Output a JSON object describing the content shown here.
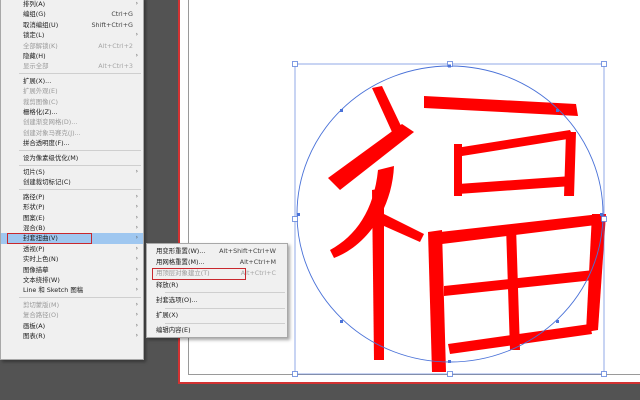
{
  "main_menu": [
    {
      "label": "排列(A)",
      "arrow": true
    },
    {
      "label": "编组(G)",
      "shortcut": "Ctrl+G"
    },
    {
      "label": "取消编组(U)",
      "shortcut": "Shift+Ctrl+G"
    },
    {
      "label": "锁定(L)",
      "arrow": true
    },
    {
      "label": "全部解锁(K)",
      "shortcut": "Alt+Ctrl+2",
      "disabled": true
    },
    {
      "label": "隐藏(H)",
      "arrow": true
    },
    {
      "label": "显示全部",
      "shortcut": "Alt+Ctrl+3",
      "disabled": true
    },
    {
      "sep": true
    },
    {
      "label": "扩展(X)..."
    },
    {
      "label": "扩展外观(E)",
      "disabled": true
    },
    {
      "label": "裁剪图像(C)",
      "disabled": true
    },
    {
      "label": "栅格化(Z)..."
    },
    {
      "label": "创建渐变网格(D)...",
      "disabled": true
    },
    {
      "label": "创建对象马赛克(J)...",
      "disabled": true
    },
    {
      "label": "拼合透明度(F)..."
    },
    {
      "sep": true
    },
    {
      "label": "设为像素级优化(M)"
    },
    {
      "sep": true
    },
    {
      "label": "切片(S)",
      "arrow": true
    },
    {
      "label": "创建裁切标记(C)"
    },
    {
      "sep": true
    },
    {
      "label": "路径(P)",
      "arrow": true
    },
    {
      "label": "形状(P)",
      "arrow": true
    },
    {
      "label": "图案(E)",
      "arrow": true
    },
    {
      "label": "混合(B)",
      "arrow": true
    },
    {
      "label": "封套扭曲(V)",
      "arrow": true,
      "highlighted": true
    },
    {
      "label": "透视(P)",
      "arrow": true
    },
    {
      "label": "实时上色(N)",
      "arrow": true
    },
    {
      "label": "图像描摹",
      "arrow": true
    },
    {
      "label": "文本绕排(W)",
      "arrow": true
    },
    {
      "label": "Line 和 Sketch 图稿",
      "arrow": true
    },
    {
      "sep": true
    },
    {
      "label": "剪切蒙版(M)",
      "arrow": true,
      "disabled": true
    },
    {
      "label": "复合路径(O)",
      "arrow": true,
      "disabled": true
    },
    {
      "label": "画板(A)",
      "arrow": true
    },
    {
      "label": "图表(R)",
      "arrow": true
    }
  ],
  "sub_menu": [
    {
      "label": "用变形重置(W)...",
      "shortcut": "Alt+Shift+Ctrl+W"
    },
    {
      "label": "用网格重置(M)...",
      "shortcut": "Alt+Ctrl+M"
    },
    {
      "label": "用顶层对象建立(T)",
      "shortcut": "Alt+Ctrl+C",
      "disabled": true,
      "boxed": true
    },
    {
      "label": "释放(R)"
    },
    {
      "sep": true
    },
    {
      "label": "封套选项(O)..."
    },
    {
      "sep": true
    },
    {
      "label": "扩展(X)"
    },
    {
      "sep": true
    },
    {
      "label": "编辑内容(E)"
    }
  ],
  "artwork": {
    "character": "福",
    "glyph_color": "#ff0000",
    "path_color": "#4a72d8"
  },
  "colors": {
    "highlight": "#9fc7f0",
    "callout_red": "#c8282e"
  }
}
